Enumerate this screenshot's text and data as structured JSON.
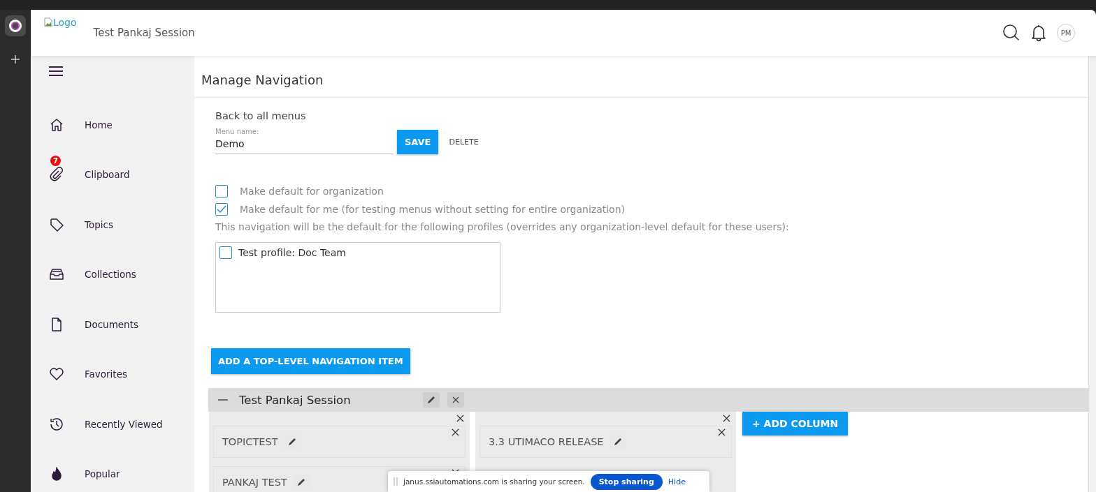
{
  "header": {
    "logo_alt": "Logo",
    "title": "Test Pankaj Session",
    "avatar": "PM"
  },
  "sidebar": {
    "items": [
      {
        "label": "Home"
      },
      {
        "label": "Clipboard",
        "badge": "7"
      },
      {
        "label": "Topics"
      },
      {
        "label": "Collections"
      },
      {
        "label": "Documents"
      },
      {
        "label": "Favorites"
      },
      {
        "label": "Recently Viewed"
      },
      {
        "label": "Popular"
      }
    ]
  },
  "page": {
    "title": "Manage Navigation",
    "back_link": "Back to all menus",
    "menu_name": {
      "label": "Menu name:",
      "value": "Demo"
    },
    "save_button": "SAVE",
    "delete_button": "DELETE",
    "options": [
      {
        "label": "Make default for organization",
        "checked": false
      },
      {
        "label": "Make default for me (for testing menus without setting for entire organization)",
        "checked": true
      }
    ],
    "profiles_note": "This navigation will be the default for the following profiles (overrides any organization-level default for these users):",
    "profiles": [
      {
        "label": "Test profile: Doc Team",
        "checked": false
      }
    ],
    "add_top_button": "ADD A TOP-LEVEL NAVIGATION ITEM",
    "section": {
      "title": "Test Pankaj Session",
      "expanded": true,
      "columns": [
        {
          "items": [
            {
              "label": "TOPICTEST"
            },
            {
              "label": "PANKAJ TEST"
            }
          ]
        },
        {
          "items": [
            {
              "label": "3.3 UTIMACO RELEASE"
            }
          ]
        }
      ],
      "add_column_button": "+ ADD COLUMN"
    }
  },
  "share_bar": {
    "message": "janus.ssiautomations.com is sharing your screen.",
    "stop_button": "Stop sharing",
    "hide_link": "Hide"
  }
}
